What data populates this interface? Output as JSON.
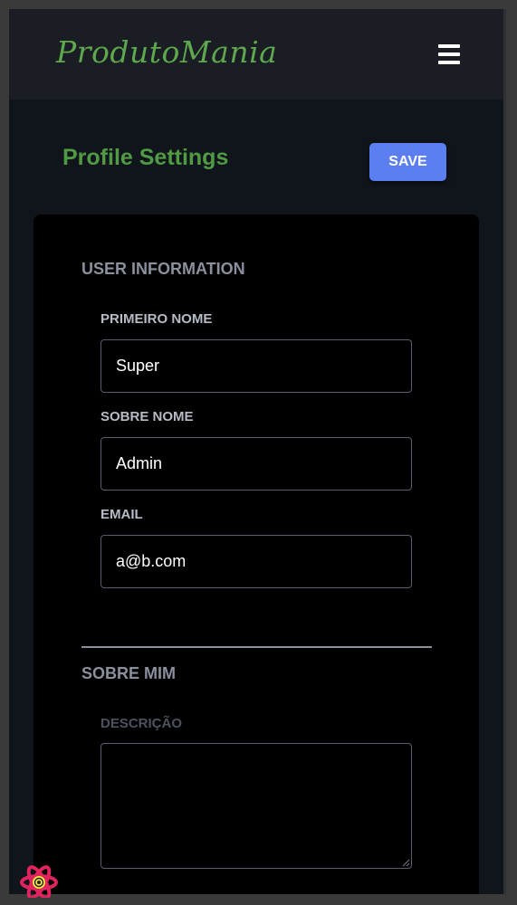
{
  "header": {
    "brand": "ProdutoMania",
    "menu_icon": "hamburger-menu-icon"
  },
  "page": {
    "title": "Profile Settings",
    "save_label": "SAVE"
  },
  "user_information": {
    "heading": "USER INFORMATION",
    "first_name": {
      "label": "PRIMEIRO NOME",
      "value": "Super"
    },
    "last_name": {
      "label": "SOBRE NOME",
      "value": "Admin"
    },
    "email": {
      "label": "EMAIL",
      "value": "a@b.com"
    }
  },
  "about": {
    "heading": "SOBRE MIM",
    "description": {
      "label": "DESCRIÇÃO",
      "value": ""
    }
  },
  "devtools": {
    "icon": "react-devtools-icon"
  },
  "colors": {
    "brand_green": "#5ea84e",
    "title_green": "#4f9a43",
    "save_blue": "#5b7ff0",
    "page_background": "#10141b",
    "card_background": "#000000"
  }
}
